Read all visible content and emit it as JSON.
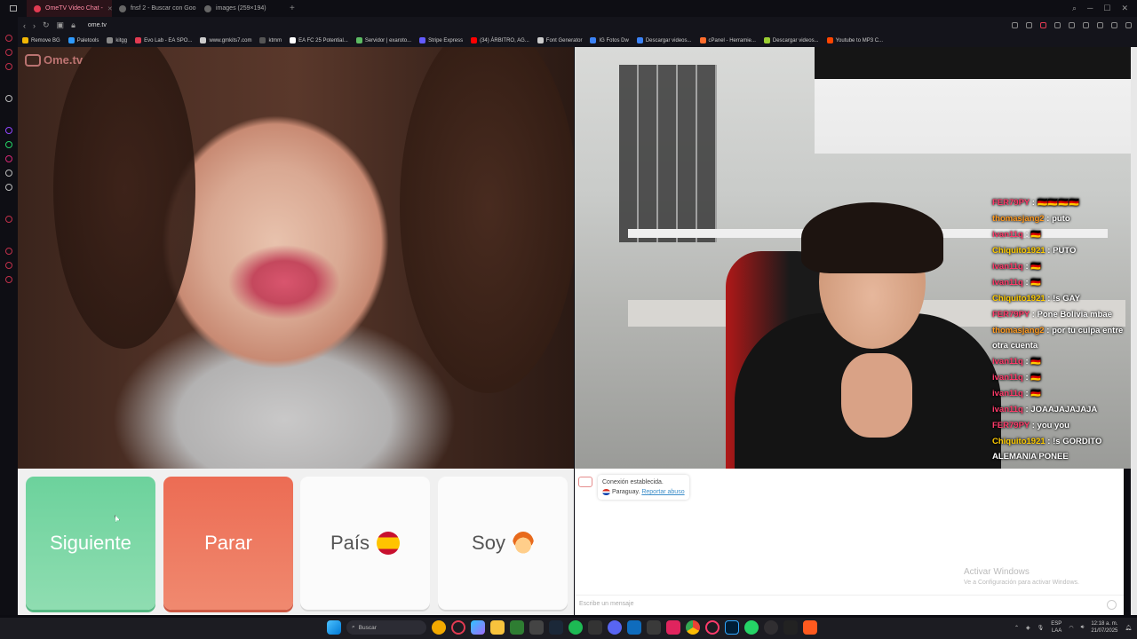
{
  "browser": {
    "tabs": [
      {
        "label": "OmeTV Video Chat -",
        "active": true
      },
      {
        "label": "fnsf 2 - Buscar con Goo",
        "active": false
      },
      {
        "label": "images (259×194)",
        "active": false
      }
    ],
    "url": "ome.tv",
    "bookmarks": [
      {
        "label": "Remove BG",
        "color": "#f2b705"
      },
      {
        "label": "Paletools",
        "color": "#2e9afe"
      },
      {
        "label": "kitgg",
        "color": "#888888"
      },
      {
        "label": "Evo Lab - EA SPO...",
        "color": "#e23b52"
      },
      {
        "label": "www.gmkits7.com",
        "color": "#cccccc"
      },
      {
        "label": "ktmm",
        "color": "#555555"
      },
      {
        "label": "EA FC 25 Potential...",
        "color": "#ffffff"
      },
      {
        "label": "Servidor | exaroto...",
        "color": "#5dbb63"
      },
      {
        "label": "Stripe Express",
        "color": "#635bff"
      },
      {
        "label": "(34) ÁRBITRO, AG...",
        "color": "#ff0000"
      },
      {
        "label": "Font Generator",
        "color": "#cccccc"
      },
      {
        "label": "IG Fotos Dw",
        "color": "#3b82f6"
      },
      {
        "label": "Descargar videos...",
        "color": "#3b82f6"
      },
      {
        "label": "cPanel - Herramie...",
        "color": "#ff6c2c"
      },
      {
        "label": "Descargar videos...",
        "color": "#9acd32"
      },
      {
        "label": "Youtube to MP3 C...",
        "color": "#ff4500"
      }
    ]
  },
  "ometv": {
    "logo_text": "Ome.tv",
    "buttons": {
      "next": "Siguiente",
      "stop": "Parar",
      "country": "País",
      "gender": "Soy"
    },
    "system_message": {
      "connected": "Conexión establecida.",
      "country": "Paraguay.",
      "report": "Reportar abuso"
    },
    "input_placeholder": "Escribe un mensaje"
  },
  "stream_chat": [
    {
      "user": "FER79PY",
      "sep": " : ",
      "msg": "🇩🇪🇩🇪🇩🇪🇩🇪",
      "color": "#ff3b6b"
    },
    {
      "user": "thomasjang2",
      "sep": " : ",
      "msg": "puto",
      "color": "#ff9a1f"
    },
    {
      "user": "ivan11q",
      "sep": " : ",
      "msg": "🇩🇪",
      "color": "#ff3b6b"
    },
    {
      "user": "Chiquito1921",
      "sep": " : ",
      "msg": "PUTO",
      "color": "#ffcc00"
    },
    {
      "user": "ivan11q",
      "sep": " : ",
      "msg": "🇩🇪",
      "color": "#ff3b6b"
    },
    {
      "user": "ivan11q",
      "sep": " : ",
      "msg": "🇩🇪",
      "color": "#ff3b6b"
    },
    {
      "user": "Chiquito1921",
      "sep": " : ",
      "msg": "!s GAY",
      "color": "#ffcc00"
    },
    {
      "user": "FER79PY",
      "sep": " : ",
      "msg": "Pone Bolivia mbae",
      "color": "#ff3b6b"
    },
    {
      "user": "thomasjang2",
      "sep": " : ",
      "msg": "por tu culpa entre otra cuenta",
      "color": "#ff9a1f"
    },
    {
      "user": "ivan11q",
      "sep": " : ",
      "msg": "🇩🇪",
      "color": "#ff3b6b"
    },
    {
      "user": "ivan11q",
      "sep": " : ",
      "msg": "🇩🇪",
      "color": "#ff3b6b"
    },
    {
      "user": "ivan11q",
      "sep": " : ",
      "msg": "🇩🇪",
      "color": "#ff3b6b"
    },
    {
      "user": "ivan11q",
      "sep": " : ",
      "msg": "JOAAJAJAJAJA",
      "color": "#ff3b6b"
    },
    {
      "user": "FER79PY",
      "sep": " : ",
      "msg": "you you",
      "color": "#ff3b6b"
    },
    {
      "user": "Chiquito1921",
      "sep": " : ",
      "msg": "!s GORDITO ALEMANIA PONEE",
      "color": "#ffcc00"
    }
  ],
  "windows_activation": {
    "title": "Activar Windows",
    "subtitle": "Ve a Configuración para activar Windows."
  },
  "taskbar": {
    "search_placeholder": "Buscar",
    "language": "ESP",
    "region": "LAA",
    "time": "12:18 a. m.",
    "date": "21/07/2025"
  }
}
